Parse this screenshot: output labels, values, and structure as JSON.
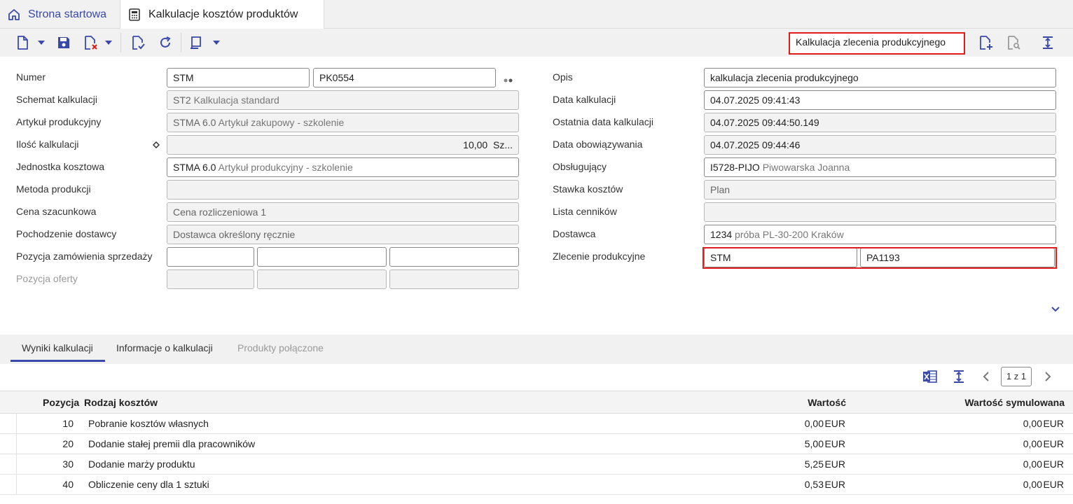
{
  "tabs": {
    "home_label": "Strona startowa",
    "active_label": "Kalkulacje kosztów produktów"
  },
  "toolbar": {
    "calculation_type": "Kalkulacja zlecenia produkcyjnego"
  },
  "form": {
    "left": {
      "numer_label": "Numer",
      "numer_prefix": "STM",
      "numer_value": "PK0554",
      "schemat_label": "Schemat kalkulacji",
      "schemat_code": "ST2",
      "schemat_desc": "Kalkulacja standard",
      "artykul_label": "Artykuł produkcyjny",
      "artykul_code": "STMA 6.0",
      "artykul_desc": "Artykuł zakupowy - szkolenie",
      "ilosc_label": "Ilość kalkulacji",
      "ilosc_value": "10,00",
      "ilosc_unit": "Sz...",
      "jednostka_label": "Jednostka kosztowa",
      "jednostka_code": "STMA 6.0",
      "jednostka_desc": "Artykuł produkcyjny - szkolenie",
      "metoda_label": "Metoda produkcji",
      "cena_label": "Cena szacunkowa",
      "cena_value": "Cena rozliczeniowa 1",
      "pochodzenie_label": "Pochodzenie dostawcy",
      "pochodzenie_value": "Dostawca określony ręcznie",
      "pozycja_zam_label": "Pozycja zamówienia sprzedaży",
      "pozycja_oferty_label": "Pozycja oferty"
    },
    "right": {
      "opis_label": "Opis",
      "opis_value": "kalkulacja zlecenia produkcyjnego",
      "data_kalk_label": "Data kalkulacji",
      "data_kalk_value": "04.07.2025  09:41:43",
      "ostatnia_label": "Ostatnia data kalkulacji",
      "ostatnia_value": "04.07.2025  09:44:50.149",
      "data_obow_label": "Data obowiązywania",
      "data_obow_value": "04.07.2025  09:44:46",
      "obslugujacy_label": "Obsługujący",
      "obslugujacy_code": "I5728-PIJO",
      "obslugujacy_name": "Piwowarska Joanna",
      "stawka_label": "Stawka kosztów",
      "stawka_value": "Plan",
      "lista_label": "Lista cenników",
      "dostawca_label": "Dostawca",
      "dostawca_code": "1234",
      "dostawca_desc": "próba PL-30-200 Kraków",
      "zlecenie_label": "Zlecenie produkcyjne",
      "zlecenie_prefix": "STM",
      "zlecenie_value": "PA1193"
    }
  },
  "bottom_tabs": {
    "wyniki": "Wyniki kalkulacji",
    "informacje": "Informacje o kalkulacji",
    "produkty": "Produkty połączone"
  },
  "pager": {
    "text": "1 z 1"
  },
  "table": {
    "headers": {
      "pozycja": "Pozycja",
      "rodzaj": "Rodzaj kosztów",
      "wartosc": "Wartość",
      "wartosc_sym": "Wartość symulowana"
    },
    "rows": [
      {
        "pozycja": "10",
        "rodzaj": "Pobranie kosztów własnych",
        "wartosc": "0,00",
        "waluta": "EUR",
        "wartosc_sym": "0,00",
        "waluta_sym": "EUR"
      },
      {
        "pozycja": "20",
        "rodzaj": "Dodanie stałej premii dla pracowników",
        "wartosc": "5,00",
        "waluta": "EUR",
        "wartosc_sym": "0,00",
        "waluta_sym": "EUR"
      },
      {
        "pozycja": "30",
        "rodzaj": "Dodanie marży produktu",
        "wartosc": "5,25",
        "waluta": "EUR",
        "wartosc_sym": "0,00",
        "waluta_sym": "EUR"
      },
      {
        "pozycja": "40",
        "rodzaj": "Obliczenie ceny dla 1 sztuki",
        "wartosc": "0,53",
        "waluta": "EUR",
        "wartosc_sym": "0,00",
        "waluta_sym": "EUR"
      }
    ]
  },
  "colors": {
    "accent": "#3949ab",
    "highlight": "#e01b1b"
  }
}
